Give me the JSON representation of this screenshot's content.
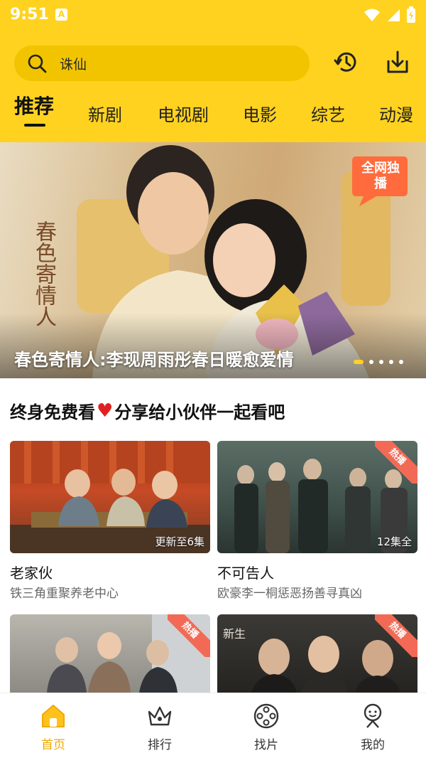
{
  "status_bar": {
    "time": "9:51",
    "notification_badge": "A"
  },
  "search": {
    "value": "诛仙"
  },
  "header_icons": [
    "history-icon",
    "download-icon"
  ],
  "tabs": [
    {
      "label": "推荐",
      "active": true
    },
    {
      "label": "新剧"
    },
    {
      "label": "电视剧"
    },
    {
      "label": "电影"
    },
    {
      "label": "综艺"
    },
    {
      "label": "动漫"
    }
  ],
  "banner": {
    "caption": "春色寄情人:李现周雨彤春日暖愈爱情",
    "poster_text": "春色寄情人",
    "badge": "全网独播",
    "slides": 5,
    "active_slide": 1
  },
  "promo": {
    "text_before": "终身免费看",
    "text_after": "分享给小伙伴一起看吧"
  },
  "cards": [
    {
      "title": "老家伙",
      "desc": "铁三角重聚养老中心",
      "label": "更新至6集",
      "hot": false
    },
    {
      "title": "不可告人",
      "desc": "欧豪李一桐惩恶扬善寻真凶",
      "label": "12集全",
      "hot": true,
      "hot_text": "热播"
    },
    {
      "title": "",
      "desc": "",
      "label": "",
      "hot": true,
      "hot_text": "热播"
    },
    {
      "title": "",
      "desc": "",
      "label": "",
      "hot": true,
      "hot_text": "热播",
      "poster_text": "新生"
    }
  ],
  "bottom_nav": [
    {
      "label": "首页",
      "icon": "home-icon",
      "active": true
    },
    {
      "label": "排行",
      "icon": "crown-icon"
    },
    {
      "label": "找片",
      "icon": "film-reel-icon"
    },
    {
      "label": "我的",
      "icon": "profile-icon"
    }
  ],
  "colors": {
    "brand": "#ffd21f",
    "accent_active": "#f0a800",
    "hot": "#f26a55"
  }
}
